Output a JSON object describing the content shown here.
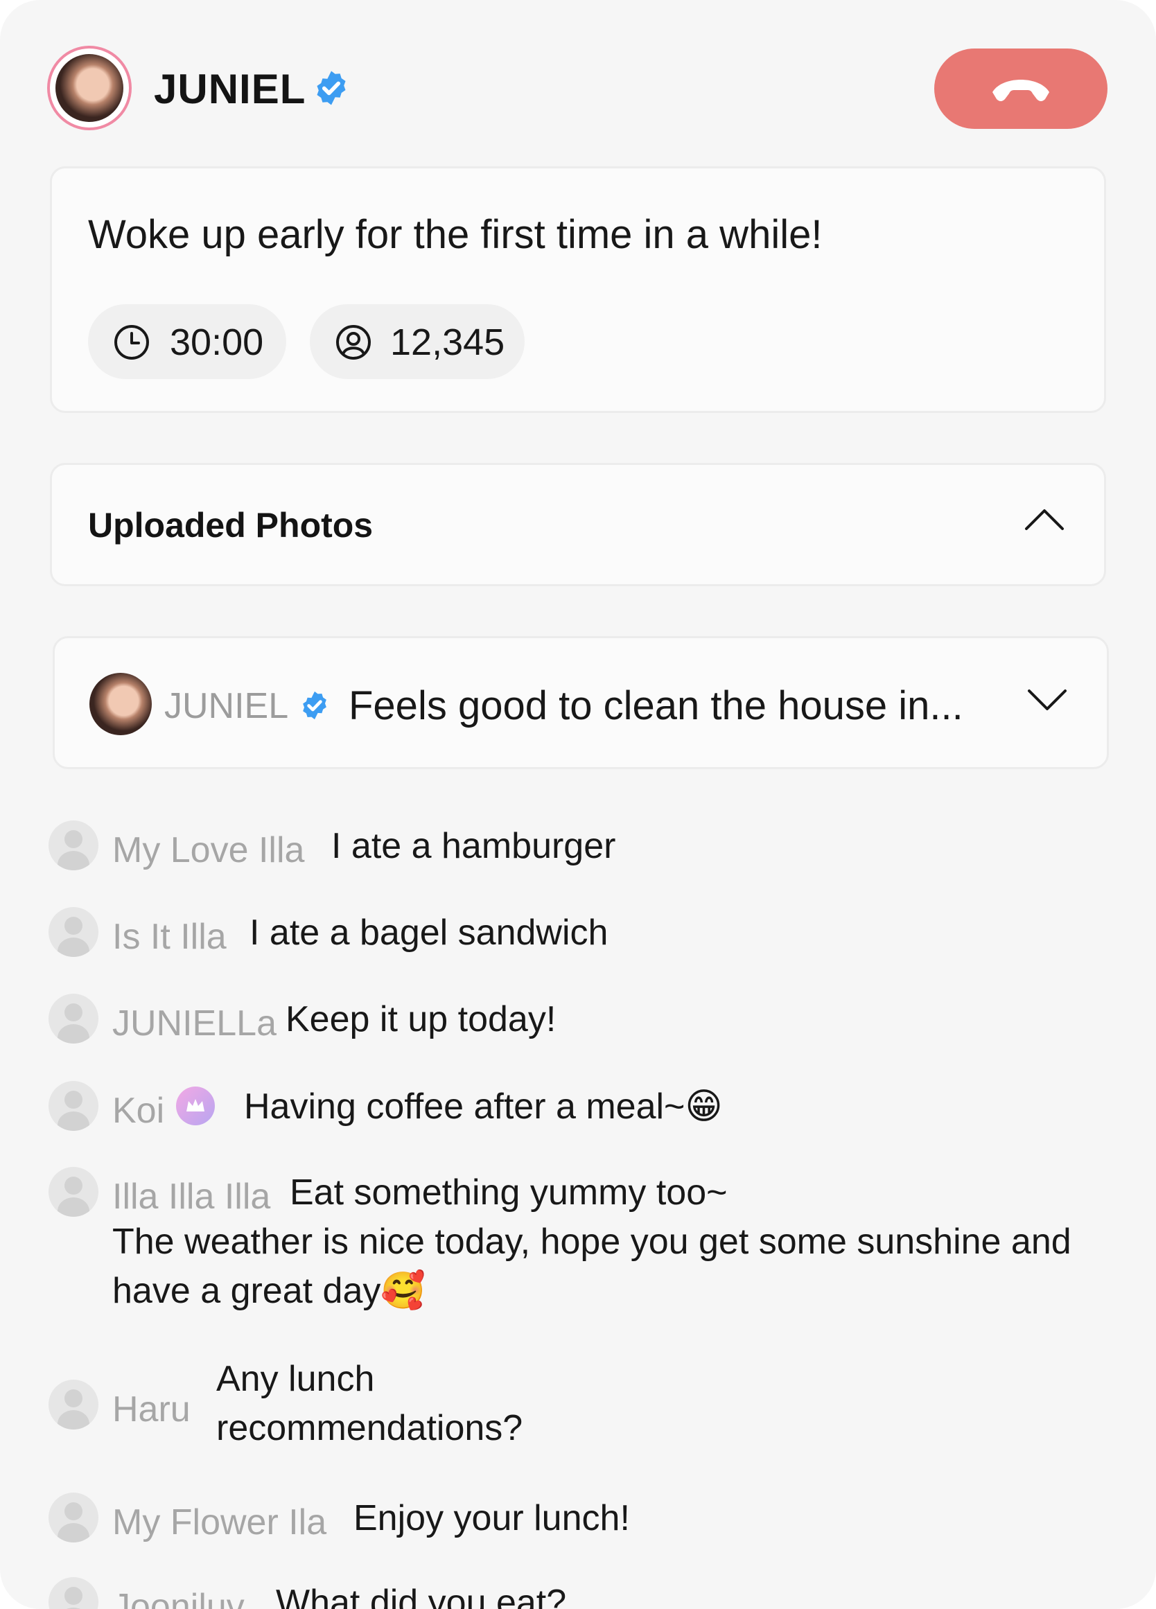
{
  "host": {
    "name": "JUNIEL",
    "verified_icon": "verified-badge-icon",
    "end_call_icon": "phone-hangup-icon"
  },
  "status": {
    "text": "Woke up early for the first time in a while!",
    "timer": "30:00",
    "viewers": "12,345"
  },
  "photos": {
    "title": "Uploaded Photos",
    "expanded": true
  },
  "pinned": {
    "name": "JUNIEL",
    "message": "Feels good to clean the house in..."
  },
  "chat": [
    {
      "name": "My Love Illa",
      "text": "I ate a hamburger"
    },
    {
      "name": "Is It Illa",
      "text": "I ate a bagel sandwich"
    },
    {
      "name": "JUNIELLa",
      "text": "Keep it up today!"
    },
    {
      "name": "Koi",
      "text": "Having coffee after a meal~😁",
      "badge": "crown-icon"
    },
    {
      "name": "Illa Illa Illa",
      "text": "Eat something yummy too~",
      "text_line2": "The weather is nice today, hope you get some sunshine and",
      "text_line3": "have a great day🥰"
    },
    {
      "name": "Haru",
      "text": "Any lunch",
      "text_line2": "recommendations?"
    },
    {
      "name": "My Flower Ila",
      "text": "Enjoy your lunch!"
    },
    {
      "name": "Jooniluv",
      "text": "What did you eat?"
    }
  ],
  "colors": {
    "end_call": "#e87873",
    "verified": "#3d9df2",
    "avatar_ring": "#f08aa4"
  }
}
